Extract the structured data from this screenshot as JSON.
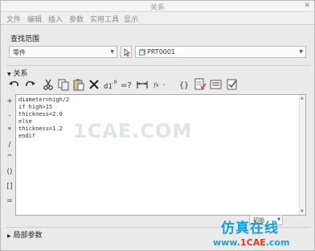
{
  "window": {
    "title": "关系",
    "close_glyph": "✕"
  },
  "menu": [
    "文件",
    "编辑",
    "插入",
    "参数",
    "实用工具",
    "显示"
  ],
  "search_scope": {
    "label": "查找范围",
    "type_value": "零件",
    "model_value": "PRT0001"
  },
  "relations": {
    "label": "关系"
  },
  "toolbar": {
    "icons": [
      "undo-icon",
      "redo-icon",
      "cut-icon",
      "copy-icon",
      "paste-icon",
      "delete-icon",
      "show-values-icon",
      "equal-icon",
      "dimension-icon",
      "function-icon",
      "braces-icon",
      "verify-icon",
      "sort-icon",
      "check-icon"
    ],
    "function_label": "fx"
  },
  "sidebar_ops": [
    "+",
    "-",
    "*",
    "/",
    "^",
    "()",
    "[]",
    "="
  ],
  "editor": {
    "lines": [
      "diameter=high/2",
      "if high>15",
      "thickness=2.0",
      "else",
      "thickness=1.2",
      "endif"
    ]
  },
  "units": {
    "value": "初始"
  },
  "local_params": {
    "label": "局部参数"
  },
  "watermark": "1CAE.COM",
  "brand": {
    "chinese": "仿真在线",
    "site_prefix": "www.",
    "site_mid": "1CAE",
    "site_suffix": ".com"
  }
}
